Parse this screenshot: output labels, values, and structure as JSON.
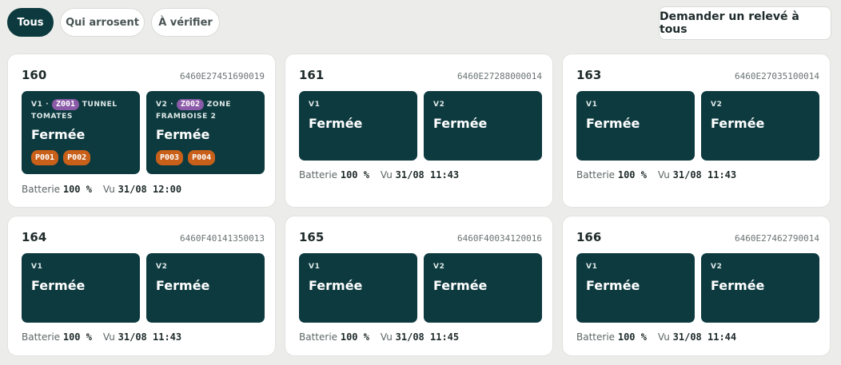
{
  "filters": {
    "all": "Tous",
    "watering": "Qui arrosent",
    "to_check": "À vérifier"
  },
  "request_all_button": "Demander un relevé à tous",
  "labels": {
    "battery": "Batterie",
    "seen": "Vu",
    "v1": "V1",
    "v2": "V2",
    "sep": "·"
  },
  "colors": {
    "accent": "#0d3a3f",
    "zone_tag": "#8b5aa8",
    "plant_tag": "#c8601a",
    "background": "#ecedea"
  },
  "cards": [
    {
      "id": "160",
      "serial": "6460E27451690019",
      "battery": "100 %",
      "seen": "31/08 12:00",
      "valves": [
        {
          "label": "V1",
          "zone_code": "Z001",
          "zone_name": "TUNNEL TOMATES",
          "state": "Fermée",
          "plants": [
            "P001",
            "P002"
          ]
        },
        {
          "label": "V2",
          "zone_code": "Z002",
          "zone_name": "ZONE FRAMBOISE 2",
          "state": "Fermée",
          "plants": [
            "P003",
            "P004"
          ]
        }
      ]
    },
    {
      "id": "161",
      "serial": "6460E27288000014",
      "battery": "100 %",
      "seen": "31/08 11:43",
      "valves": [
        {
          "label": "V1",
          "state": "Fermée"
        },
        {
          "label": "V2",
          "state": "Fermée"
        }
      ]
    },
    {
      "id": "163",
      "serial": "6460E27035100014",
      "battery": "100 %",
      "seen": "31/08 11:43",
      "valves": [
        {
          "label": "V1",
          "state": "Fermée"
        },
        {
          "label": "V2",
          "state": "Fermée"
        }
      ]
    },
    {
      "id": "164",
      "serial": "6460F40141350013",
      "battery": "100 %",
      "seen": "31/08 11:43",
      "valves": [
        {
          "label": "V1",
          "state": "Fermée"
        },
        {
          "label": "V2",
          "state": "Fermée"
        }
      ]
    },
    {
      "id": "165",
      "serial": "6460F40034120016",
      "battery": "100 %",
      "seen": "31/08 11:45",
      "valves": [
        {
          "label": "V1",
          "state": "Fermée"
        },
        {
          "label": "V2",
          "state": "Fermée"
        }
      ]
    },
    {
      "id": "166",
      "serial": "6460E27462790014",
      "battery": "100 %",
      "seen": "31/08 11:44",
      "valves": [
        {
          "label": "V1",
          "state": "Fermée"
        },
        {
          "label": "V2",
          "state": "Fermée"
        }
      ]
    }
  ]
}
